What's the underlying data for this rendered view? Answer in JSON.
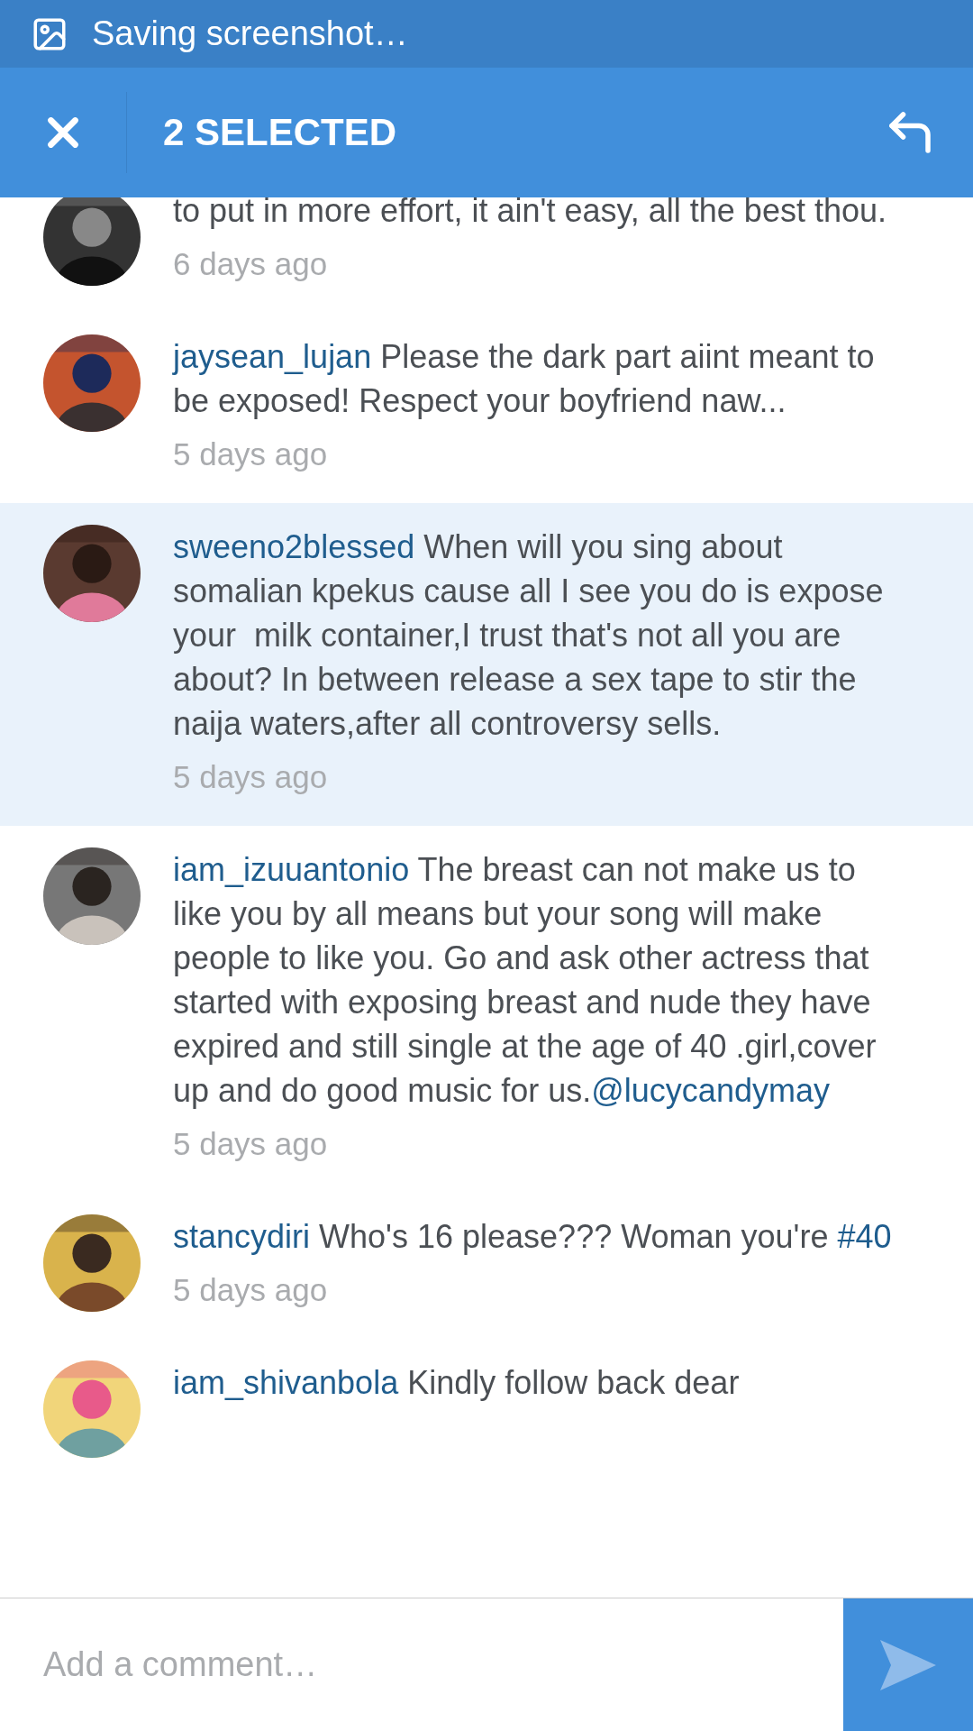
{
  "notification": {
    "text": "Saving screenshot…"
  },
  "action_bar": {
    "title": "2 SELECTED"
  },
  "comments": [
    {
      "parts": [
        {
          "kind": "text",
          "text": "to put in more effort, it ain't easy, all the best thou."
        }
      ],
      "time": "6 days ago",
      "selected": false
    },
    {
      "username": "jaysean_lujan",
      "parts": [
        {
          "kind": "text",
          "text": "Please the dark part aiint meant to be exposed! Respect your boyfriend naw..."
        }
      ],
      "time": "5 days ago",
      "selected": false
    },
    {
      "username": "sweeno2blessed",
      "parts": [
        {
          "kind": "text",
          "text": "When will you sing about somalian kpekus cause all I see you do is expose your  milk container,I trust that's not all you are about? In between release a sex tape to stir the naija waters,after all controversy sells."
        }
      ],
      "time": "5 days ago",
      "selected": true
    },
    {
      "username": "iam_izuuantonio",
      "parts": [
        {
          "kind": "text",
          "text": "The breast can not make us to like you by all means but your song will make people to like you. Go and ask other actress that started with exposing breast and nude they have expired and still single at the age of 40 .girl,cover up and do good music for us."
        },
        {
          "kind": "link",
          "text": "@lucycandymay"
        }
      ],
      "time": "5 days ago",
      "selected": false
    },
    {
      "username": "stancydiri",
      "parts": [
        {
          "kind": "text",
          "text": "Who's 16 please??? Woman you're "
        },
        {
          "kind": "link",
          "text": "#40"
        }
      ],
      "time": "5 days ago",
      "selected": false
    },
    {
      "username": "iam_shivanbola",
      "parts": [
        {
          "kind": "text",
          "text": "Kindly follow back dear"
        }
      ],
      "selected": false
    }
  ],
  "composer": {
    "placeholder": "Add a comment…"
  }
}
